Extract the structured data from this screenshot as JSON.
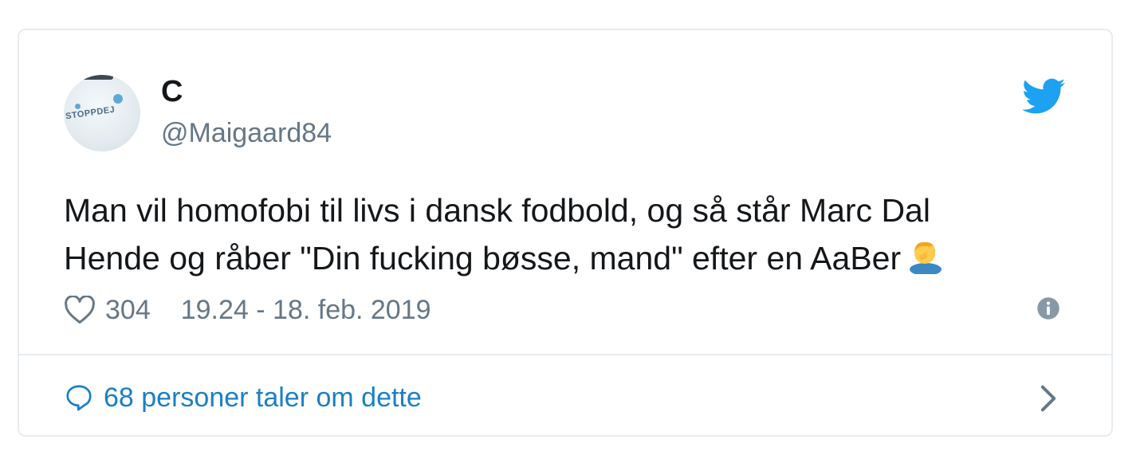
{
  "tweet": {
    "display_name": "C",
    "handle": "@Maigaard84",
    "avatar_text": "STOPPDEJ",
    "text_line1": "Man vil homofobi til livs i dansk fodbold, og så står Marc Dal",
    "text_line2": "Hende og råber \"Din fucking bøsse, mand\" efter en AaBer",
    "emoji": "person-facepalming-emoji",
    "likes": "304",
    "timestamp": "19.24 - 18. feb. 2019",
    "conversation_link": "68 personer taler om dette"
  },
  "icons": {
    "brand": "twitter-bird-icon",
    "like": "heart-icon",
    "info": "info-icon",
    "reply": "speech-bubble-icon",
    "more": "chevron-right-icon"
  },
  "colors": {
    "twitter_blue": "#1da1f2",
    "link_blue": "#1b7fc4",
    "text": "#14171a",
    "secondary": "#657786",
    "border": "#e6ecf0"
  }
}
